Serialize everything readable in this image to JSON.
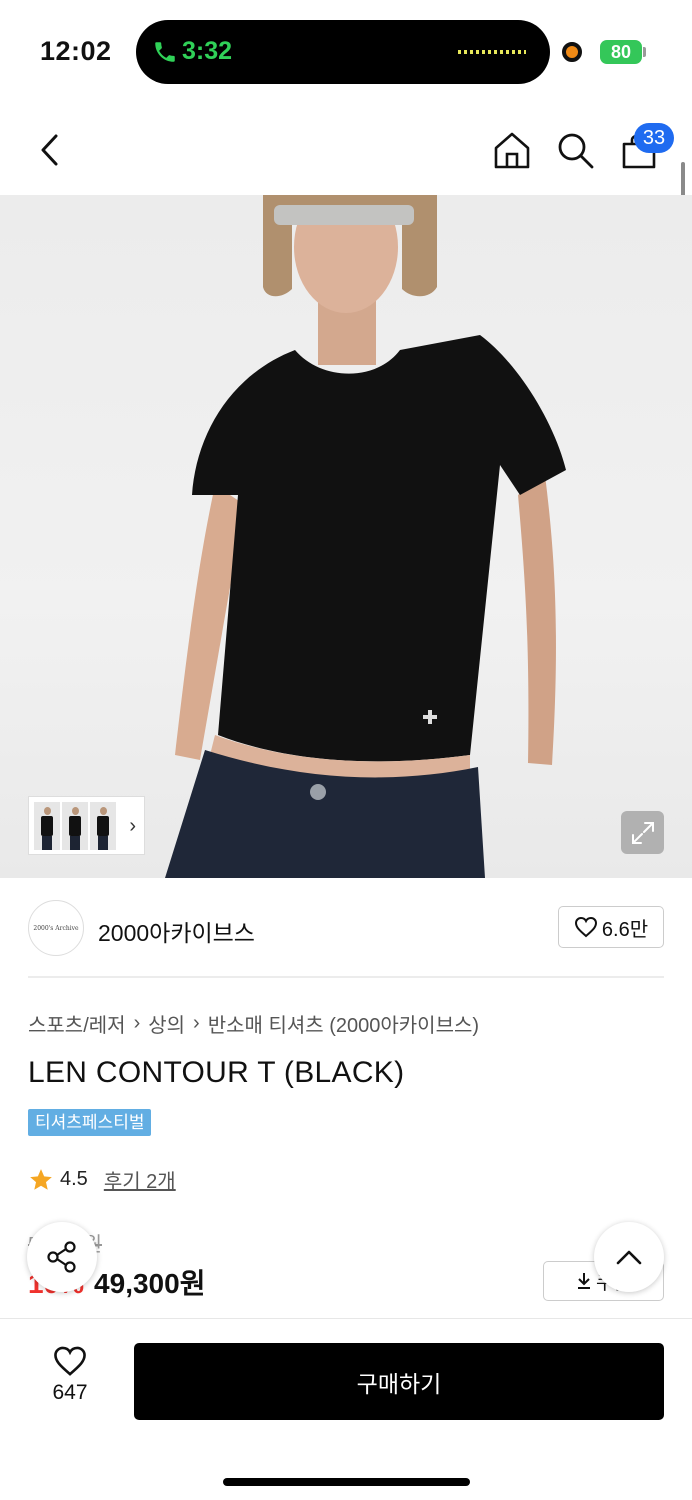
{
  "status_bar": {
    "time": "12:02",
    "call_time": "3:32",
    "battery": "80",
    "colors": {
      "call": "#30d158",
      "battery": "#34c759",
      "recording": "#f08a16"
    }
  },
  "header": {
    "back_icon": "chevron-left-icon",
    "home_icon": "home-icon",
    "search_icon": "search-icon",
    "cart_icon": "shopping-bag-icon",
    "cart_count": "33",
    "badge_color": "#1f6bf0"
  },
  "gallery": {
    "expand_icon": "expand-icon",
    "thumb_next_icon": "chevron-right-icon"
  },
  "brand": {
    "logo_text": "2000's Archive",
    "name": "2000아카이브스",
    "likes": "6.6만"
  },
  "breadcrumb": [
    "스포츠/레저",
    "상의",
    "반소매 티셔츠 (2000아카이브스)"
  ],
  "product": {
    "title": "LEN CONTOUR T (BLACK)",
    "tag": "티셔츠페스티벌",
    "tag_color": "#62aee3",
    "rating": "4.5",
    "reviews": "후기 2개",
    "original_price": "5___0원",
    "discount": "10%",
    "price": "49,300원",
    "coupon_label": "쿠폰",
    "discount_color": "#f0322d"
  },
  "bottom": {
    "wish_count": "647",
    "buy_label": "구매하기"
  }
}
